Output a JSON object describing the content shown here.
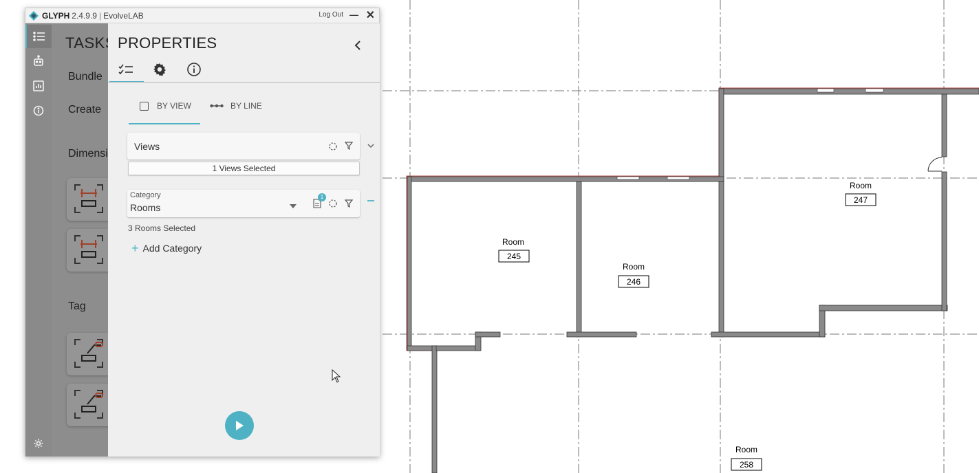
{
  "window": {
    "app_name": "GLYPH",
    "version": "2.4.9.9",
    "separator": "|",
    "company": "EvolveLAB",
    "logout_label": "Log Out",
    "minimize_glyph": "—",
    "close_glyph": "✕"
  },
  "rail": {
    "items": [
      "list-icon",
      "robot-icon",
      "chart-icon",
      "info-icon"
    ],
    "bottom": "gear-icon"
  },
  "tasks": {
    "title": "TASKS",
    "items": [
      "Bundle",
      "Create",
      "Dimensi",
      "Tag"
    ]
  },
  "properties": {
    "title": "PROPERTIES",
    "tabs": [
      "checklist-icon",
      "gear-icon",
      "info-icon"
    ],
    "mode_tabs": [
      {
        "label": "BY VIEW",
        "active": true
      },
      {
        "label": "BY LINE",
        "active": false
      }
    ],
    "views_card": {
      "label": "Views",
      "selected_text": "1 Views Selected"
    },
    "category_card": {
      "caption": "Category",
      "value": "Rooms",
      "badge_count": "1",
      "selected_text": "3 Rooms Selected"
    },
    "add_category_label": "Add Category",
    "run_button": "play-icon"
  },
  "plan": {
    "rooms": [
      {
        "label": "Room",
        "number": "245"
      },
      {
        "label": "Room",
        "number": "246"
      },
      {
        "label": "Room",
        "number": "247"
      },
      {
        "label": "Room",
        "number": "258"
      }
    ]
  },
  "colors": {
    "accent": "#4fb2c4",
    "wall": "#808080",
    "highlight_wall": "#b04848",
    "rail": "#8a8a8a",
    "panel": "#efefef"
  }
}
